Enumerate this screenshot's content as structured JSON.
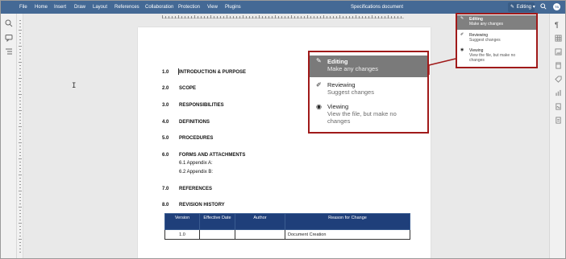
{
  "menubar": {
    "items": [
      "File",
      "Home",
      "Insert",
      "Draw",
      "Layout",
      "References",
      "Collaboration",
      "Protection",
      "View",
      "Plugins"
    ],
    "document_title": "Specifications document",
    "mode_label": "Editing",
    "user_initials": "TS"
  },
  "colors": {
    "menubar": "#446995",
    "table_header": "#1f3f7a",
    "highlight_border": "#a01a1a",
    "selected_item": "#808080"
  },
  "document": {
    "sections": [
      {
        "num": "1.0",
        "title": "INTRODUCTION & PURPOSE"
      },
      {
        "num": "2.0",
        "title": "SCOPE"
      },
      {
        "num": "3.0",
        "title": "RESPONSIBILITIES"
      },
      {
        "num": "4.0",
        "title": "DEFINITIONS"
      },
      {
        "num": "5.0",
        "title": "PROCEDURES"
      },
      {
        "num": "6.0",
        "title": "FORMS AND ATTACHMENTS"
      },
      {
        "num": "7.0",
        "title": "REFERENCES"
      },
      {
        "num": "8.0",
        "title": "REVISION HISTORY"
      }
    ],
    "subitems": [
      "6.1 Appendix A:",
      "6.2 Appendix B:"
    ],
    "revision_table": {
      "headers": [
        "Version",
        "Effective Date",
        "Author",
        "Reason for Change"
      ],
      "rows": [
        [
          "1.0",
          "",
          "",
          "Document Creation"
        ]
      ]
    }
  },
  "mode_menu": {
    "items": [
      {
        "label": "Editing",
        "desc": "Make any changes",
        "icon": "pencil-icon",
        "selected": true
      },
      {
        "label": "Reviewing",
        "desc": "Suggest changes",
        "icon": "review-icon",
        "selected": false
      },
      {
        "label": "Viewing",
        "desc": "View the file, but make no changes",
        "icon": "eye-icon",
        "selected": false
      }
    ]
  },
  "callout": {
    "items": [
      {
        "label": "Editing",
        "desc": "Make any changes"
      },
      {
        "label": "Reviewing",
        "desc": "Suggest changes"
      },
      {
        "label": "Viewing",
        "desc_line1": "View the file, but make no",
        "desc_line2": "changes"
      }
    ]
  }
}
